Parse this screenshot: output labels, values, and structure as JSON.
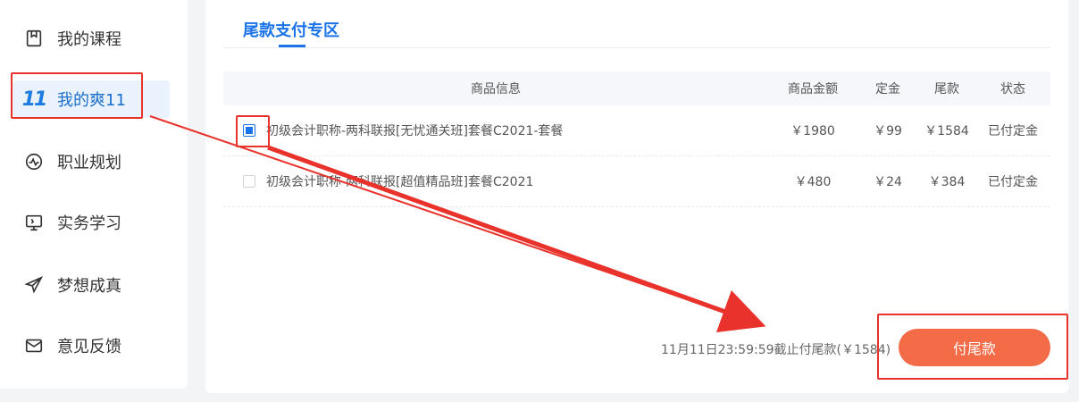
{
  "sidebar": {
    "items": [
      {
        "label": "我的课程",
        "icon": "bookmark-icon",
        "active": false
      },
      {
        "label": "我的爽11",
        "icon": "eleven-logo-icon",
        "logo_text": "11",
        "active": true
      },
      {
        "label": "职业规划",
        "icon": "pulse-circle-icon",
        "active": false
      },
      {
        "label": "实务学习",
        "icon": "monitor-icon",
        "active": false
      },
      {
        "label": "梦想成真",
        "icon": "paper-plane-icon",
        "active": false
      },
      {
        "label": "意见反馈",
        "icon": "mail-icon",
        "active": false
      }
    ]
  },
  "main": {
    "tab_title": "尾款支付专区",
    "table": {
      "headers": {
        "info": "商品信息",
        "amount": "商品金额",
        "deposit": "定金",
        "balance": "尾款",
        "status": "状态"
      },
      "rows": [
        {
          "name": "初级会计职称-两科联报[无忧通关班]套餐C2021-套餐",
          "amount": "￥1980",
          "deposit": "￥99",
          "balance": "￥1584",
          "status": "已付定金",
          "checked": true
        },
        {
          "name": "初级会计职称-两科联报[超值精品班]套餐C2021",
          "amount": "￥480",
          "deposit": "￥24",
          "balance": "￥384",
          "status": "已付定金",
          "checked": false
        }
      ]
    },
    "deadline_text": "11月11日23:59:59截止付尾款(￥1584)",
    "pay_button": "付尾款"
  },
  "colors": {
    "accent": "#1a73e8",
    "pay_button": "#f36b47",
    "annotation": "#e8322b"
  }
}
